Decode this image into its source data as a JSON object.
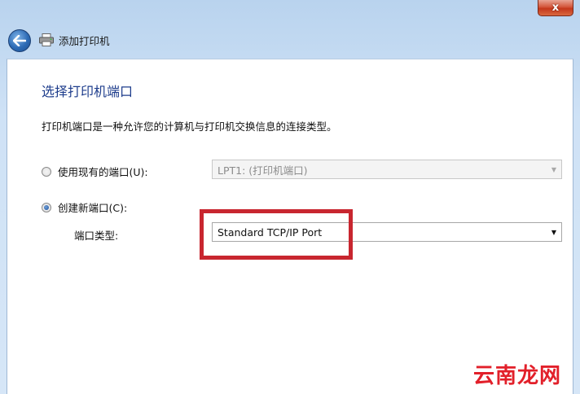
{
  "window": {
    "close_glyph": "x",
    "title": "添加打印机"
  },
  "icons": {
    "back": "back-arrow-icon",
    "printer": "printer-icon",
    "close": "close-icon"
  },
  "page": {
    "heading": "选择打印机端口",
    "description": "打印机端口是一种允许您的计算机与打印机交换信息的连接类型。"
  },
  "options": {
    "existing": {
      "label": "使用现有的端口(U):",
      "checked": false,
      "select_value": "LPT1: (打印机端口)",
      "enabled": false
    },
    "create": {
      "label": "创建新端口(C):",
      "checked": true,
      "port_type_label": "端口类型:",
      "select_value": "Standard TCP/IP Port",
      "enabled": true
    }
  },
  "annotation": {
    "highlight_color": "#c8262f"
  },
  "watermark": {
    "text": "云南龙网",
    "color": "#e2202a"
  }
}
